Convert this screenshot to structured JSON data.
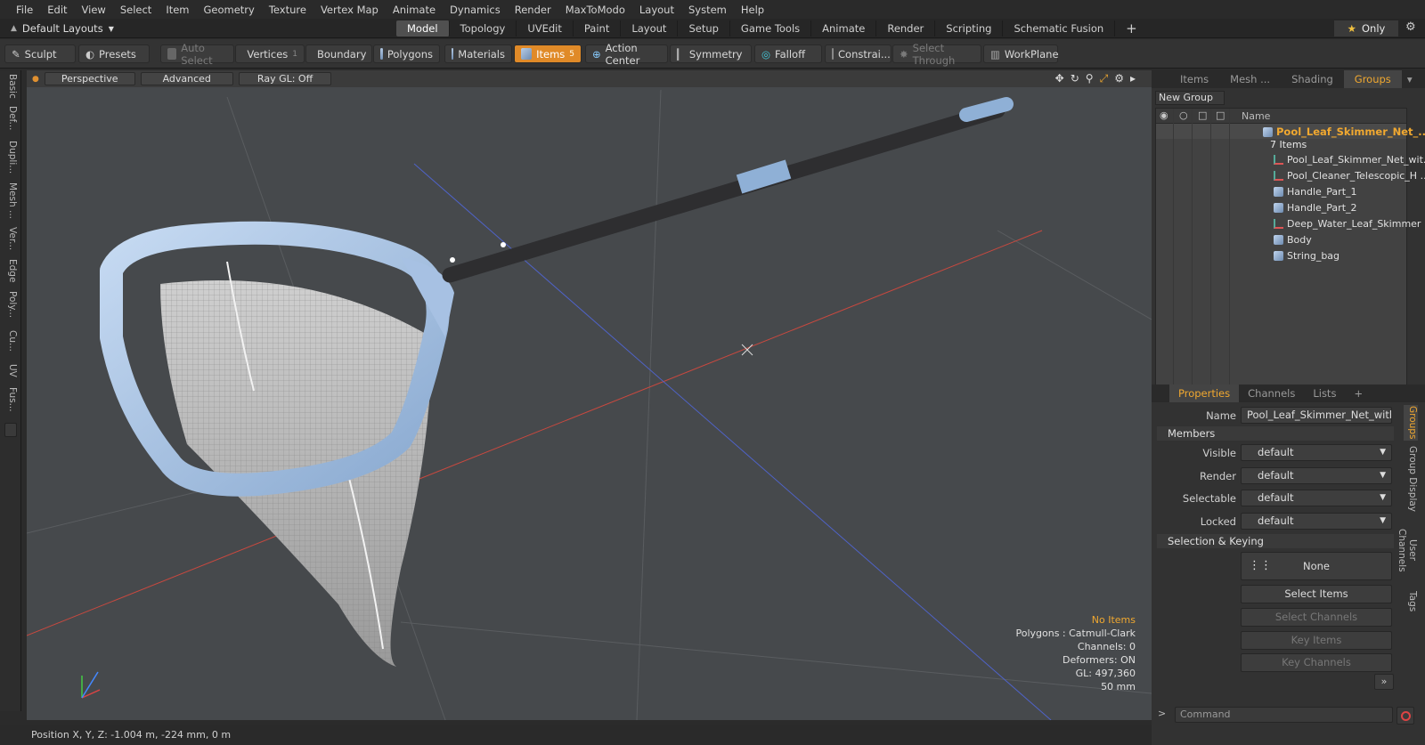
{
  "menubar": {
    "items": [
      "File",
      "Edit",
      "View",
      "Select",
      "Item",
      "Geometry",
      "Texture",
      "Vertex Map",
      "Animate",
      "Dynamics",
      "Render",
      "MaxToModo",
      "Layout",
      "System",
      "Help"
    ]
  },
  "tabrow": {
    "layout_label": "Default Layouts",
    "tabs": [
      "Model",
      "Topology",
      "UVEdit",
      "Paint",
      "Layout",
      "Setup",
      "Game Tools",
      "Animate",
      "Render",
      "Scripting",
      "Schematic Fusion"
    ],
    "active_tab": "Model",
    "only_label": "Only"
  },
  "toolbar": {
    "sculpt": "Sculpt",
    "presets": "Presets",
    "auto_select": "Auto Select",
    "vertices": "Vertices",
    "vertices_count": "1",
    "boundary": "Boundary",
    "polygons": "Polygons",
    "materials": "Materials",
    "items": "Items",
    "items_count": "5",
    "action_center": "Action Center",
    "symmetry": "Symmetry",
    "falloff": "Falloff",
    "constraints": "Constrai...",
    "select_through": "Select Through",
    "workplane": "WorkPlane"
  },
  "left_tabs": [
    "Basic",
    "Def...",
    "Dupli...",
    "Mesh ...",
    "Ver...",
    "Edge",
    "Poly...",
    "Cu...",
    "UV",
    "Fus..."
  ],
  "viewport": {
    "view_mode": "Perspective",
    "shading": "Advanced",
    "raygl": "Ray GL: Off",
    "info": {
      "no_items": "No Items",
      "polygons": "Polygons : Catmull-Clark",
      "channels": "Channels: 0",
      "deformers": "Deformers: ON",
      "gl": "GL: 497,360",
      "scale": "50 mm"
    }
  },
  "status": {
    "position": "Position X, Y, Z:   -1.004 m, -224 mm, 0 m"
  },
  "right_panel": {
    "tabs": [
      "Items",
      "Mesh ...",
      "Shading",
      "Groups"
    ],
    "active_tab": "Groups",
    "new_group": "New Group",
    "tree_header": "Name",
    "group_name": "Pool_Leaf_Skimmer_Net_...",
    "group_count": "7 Items",
    "children": [
      {
        "name": "Pool_Leaf_Skimmer_Net_wit...",
        "type": "locator"
      },
      {
        "name": "Pool_Cleaner_Telescopic_H ...",
        "type": "locator"
      },
      {
        "name": "Handle_Part_1",
        "type": "mesh"
      },
      {
        "name": "Handle_Part_2",
        "type": "mesh"
      },
      {
        "name": "Deep_Water_Leaf_Skimmer",
        "type": "locator"
      },
      {
        "name": "Body",
        "type": "mesh"
      },
      {
        "name": "String_bag",
        "type": "mesh"
      }
    ]
  },
  "properties": {
    "tabs": [
      "Properties",
      "Channels",
      "Lists"
    ],
    "active_tab": "Properties",
    "name_label": "Name",
    "name_value": "Pool_Leaf_Skimmer_Net_with_Ha",
    "members_section": "Members",
    "visible_label": "Visible",
    "visible_value": "default",
    "render_label": "Render",
    "render_value": "default",
    "selectable_label": "Selectable",
    "selectable_value": "default",
    "locked_label": "Locked",
    "locked_value": "default",
    "selection_section": "Selection & Keying",
    "none_label": "None",
    "select_items": "Select Items",
    "select_channels": "Select Channels",
    "key_items": "Key Items",
    "key_channels": "Key Channels",
    "side_tabs": [
      "Groups",
      "Group Display",
      "User Channels",
      "Tags"
    ],
    "command_placeholder": "Command"
  },
  "colors": {
    "accent": "#f0a830",
    "active_tool": "#e08a28",
    "viewport_bg": "#46494c",
    "mesh_blue": "#a9c4e6"
  }
}
